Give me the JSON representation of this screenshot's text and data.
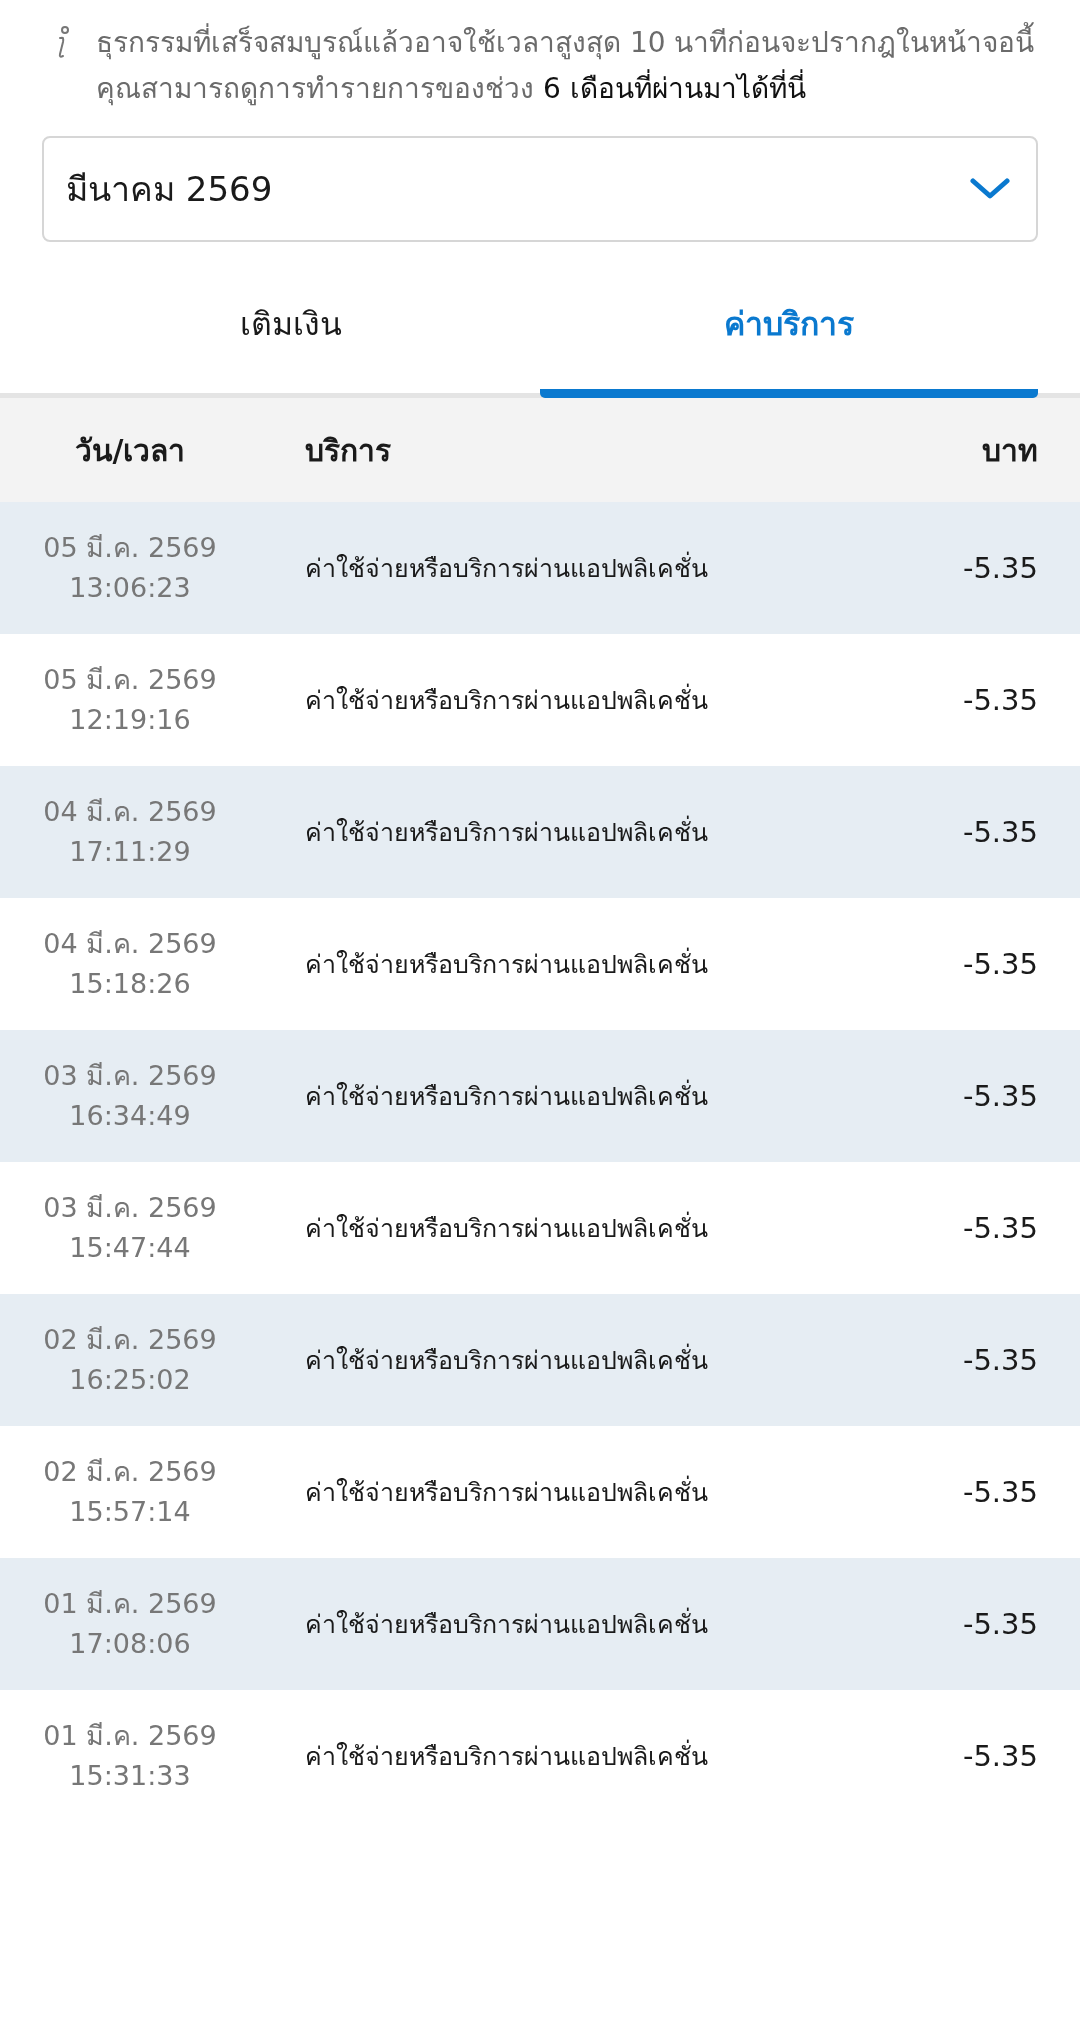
{
  "notice": "ธุรกรรมที่เสร็จสมบูรณ์แล้วอาจใช้เวลาสูงสุด 10 นาทีก่อนจะปรากฎในหน้าจอนี้ คุณสามารถดูการทำรายการของช่วง **6 เดือนที่ผ่านมาได้ที่นี่**",
  "month_select": {
    "value": "มีนาคม 2569"
  },
  "tabs": [
    {
      "label": "เติมเงิน",
      "selected": false
    },
    {
      "label": "ค่าบริการ",
      "selected": true
    }
  ],
  "table": {
    "columns": [
      "วัน/เวลา",
      "บริการ",
      "บาท"
    ],
    "rows": [
      {
        "date": "05 มี.ค. 2569",
        "time": "13:06:23",
        "service": "ค่าใช้จ่ายหรือบริการผ่านแอปพลิเคชั่น",
        "amount": "-5.35"
      },
      {
        "date": "05 มี.ค. 2569",
        "time": "12:19:16",
        "service": "ค่าใช้จ่ายหรือบริการผ่านแอปพลิเคชั่น",
        "amount": "-5.35"
      },
      {
        "date": "04 มี.ค. 2569",
        "time": "17:11:29",
        "service": "ค่าใช้จ่ายหรือบริการผ่านแอปพลิเคชั่น",
        "amount": "-5.35"
      },
      {
        "date": "04 มี.ค. 2569",
        "time": "15:18:26",
        "service": "ค่าใช้จ่ายหรือบริการผ่านแอปพลิเคชั่น",
        "amount": "-5.35"
      },
      {
        "date": "03 มี.ค. 2569",
        "time": "16:34:49",
        "service": "ค่าใช้จ่ายหรือบริการผ่านแอปพลิเคชั่น",
        "amount": "-5.35"
      },
      {
        "date": "03 มี.ค. 2569",
        "time": "15:47:44",
        "service": "ค่าใช้จ่ายหรือบริการผ่านแอปพลิเคชั่น",
        "amount": "-5.35"
      },
      {
        "date": "02 มี.ค. 2569",
        "time": "16:25:02",
        "service": "ค่าใช้จ่ายหรือบริการผ่านแอปพลิเคชั่น",
        "amount": "-5.35"
      },
      {
        "date": "02 มี.ค. 2569",
        "time": "15:57:14",
        "service": "ค่าใช้จ่ายหรือบริการผ่านแอปพลิเคชั่น",
        "amount": "-5.35"
      },
      {
        "date": "01 มี.ค. 2569",
        "time": "17:08:06",
        "service": "ค่าใช้จ่ายหรือบริการผ่านแอปพลิเคชั่น",
        "amount": "-5.35"
      },
      {
        "date": "01 มี.ค. 2569",
        "time": "15:31:33",
        "service": "ค่าใช้จ่ายหรือบริการผ่านแอปพลิเคชั่น",
        "amount": "-5.35"
      }
    ]
  }
}
